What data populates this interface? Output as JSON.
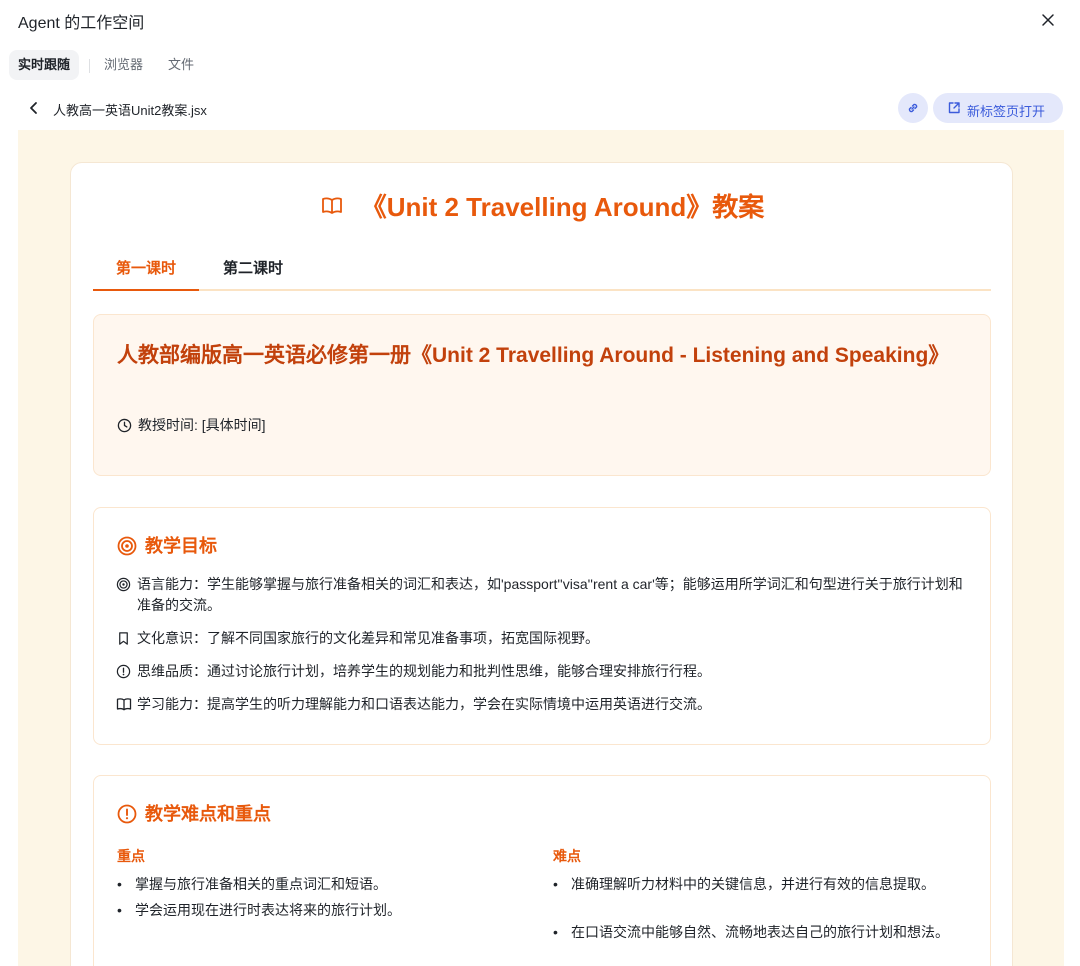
{
  "workspace": {
    "title": "Agent 的工作空间",
    "tabs": [
      {
        "label": "实时跟随",
        "active": true
      },
      {
        "label": "浏览器",
        "active": false
      },
      {
        "label": "文件",
        "active": false
      }
    ]
  },
  "filebar": {
    "file_name": "人教高一英语Unit2教案.jsx",
    "open_new_tab_label": "新标签页打开"
  },
  "doc": {
    "title": "《Unit 2 Travelling Around》教案",
    "lesson_tabs": [
      {
        "label": "第一课时",
        "active": true
      },
      {
        "label": "第二课时",
        "active": false
      }
    ],
    "info": {
      "title": "人教部编版高一英语必修第一册《Unit 2 Travelling Around - Listening and Speaking》",
      "time": "教授时间: [具体时间]"
    },
    "goals": {
      "heading": "教学目标",
      "items": [
        {
          "icon": "target-icon",
          "text": "语言能力：学生能够掌握与旅行准备相关的词汇和表达，如'passport''visa''rent a car'等；能够运用所学词汇和句型进行关于旅行计划和准备的交流。"
        },
        {
          "icon": "bookmark-icon",
          "text": "文化意识：了解不同国家旅行的文化差异和常见准备事项，拓宽国际视野。"
        },
        {
          "icon": "alert-circle-icon",
          "text": "思维品质：通过讨论旅行计划，培养学生的规划能力和批判性思维，能够合理安排旅行行程。"
        },
        {
          "icon": "open-book-icon",
          "text": "学习能力：提高学生的听力理解能力和口语表达能力，学会在实际情境中运用英语进行交流。"
        }
      ]
    },
    "difficulties": {
      "heading": "教学难点和重点",
      "key_points": {
        "title": "重点",
        "items": [
          "掌握与旅行准备相关的重点词汇和短语。",
          "学会运用现在进行时表达将来的旅行计划。"
        ]
      },
      "hard_points": {
        "title": "难点",
        "items": [
          "准确理解听力材料中的关键信息，并进行有效的信息提取。",
          "在口语交流中能够自然、流畅地表达自己的旅行计划和想法。"
        ]
      }
    }
  },
  "colors": {
    "accent": "#e8590c",
    "accent_dark": "#c2410c",
    "preview_bg": "#fdf6e6",
    "button_bg": "#e4e8fb",
    "button_text": "#3b5bdb"
  }
}
